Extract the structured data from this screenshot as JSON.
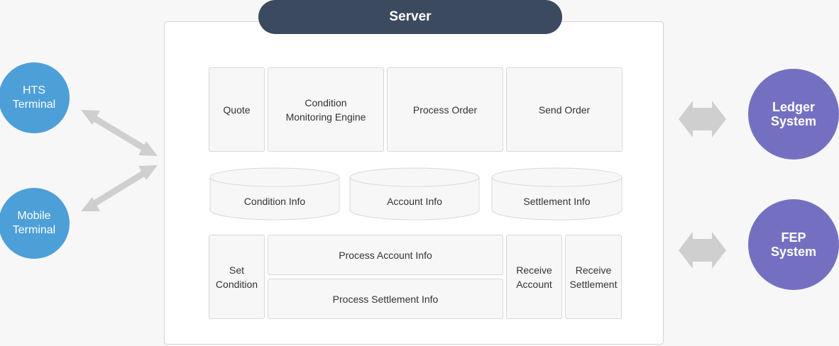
{
  "server": {
    "title": "Server"
  },
  "clients": [
    {
      "label": "HTS\nTerminal"
    },
    {
      "label": "Mobile\nTerminal"
    }
  ],
  "external": [
    {
      "label": "Ledger\nSystem"
    },
    {
      "label": "FEP\nSystem"
    }
  ],
  "top_modules": [
    {
      "label": "Quote"
    },
    {
      "label": "Condition\nMonitoring Engine"
    },
    {
      "label": "Process Order"
    },
    {
      "label": "Send Order"
    }
  ],
  "databases": [
    {
      "label": "Condition Info"
    },
    {
      "label": "Account Info"
    },
    {
      "label": "Settlement Info"
    }
  ],
  "bottom_modules": {
    "set_condition": "Set\nCondition",
    "process_account": "Process Account Info",
    "process_settlement": "Process Settlement Info",
    "receive_account": "Receive\nAccount",
    "receive_settlement": "Receive\nSettlement"
  },
  "colors": {
    "client": "#4d9fd8",
    "external": "#7470c1",
    "server_title": "#3b4a5e",
    "arrow": "#cfcfcf"
  }
}
